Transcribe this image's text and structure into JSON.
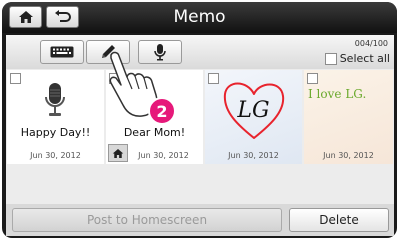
{
  "header": {
    "title": "Memo",
    "home_icon": "home-icon",
    "back_icon": "back-arrow-icon"
  },
  "toolbar": {
    "buttons": [
      "keyboard-icon",
      "pen-icon",
      "microphone-icon"
    ],
    "counter": "004/100",
    "select_all_label": "Select all"
  },
  "memos": [
    {
      "type": "voice",
      "text": "Happy Day!!",
      "date": "Jun 30, 2012",
      "icon": "microphone-icon"
    },
    {
      "type": "text",
      "text": "Dear Mom!",
      "date": "Jun 30, 2012",
      "badge_icon": "home-icon"
    },
    {
      "type": "drawing",
      "text": "LG",
      "date": "Jun 30, 2012"
    },
    {
      "type": "handwriting",
      "text": "I love LG.",
      "date": "Jun 30, 2012"
    }
  ],
  "bottom": {
    "post_label": "Post to Homescreen",
    "delete_label": "Delete"
  },
  "overlay": {
    "step_number": "2",
    "hand_icon": "pointing-hand-icon"
  },
  "colors": {
    "accent_step": "#e6197a",
    "drawing_red": "#e8232d",
    "handwriting_green": "#6aa92c"
  }
}
